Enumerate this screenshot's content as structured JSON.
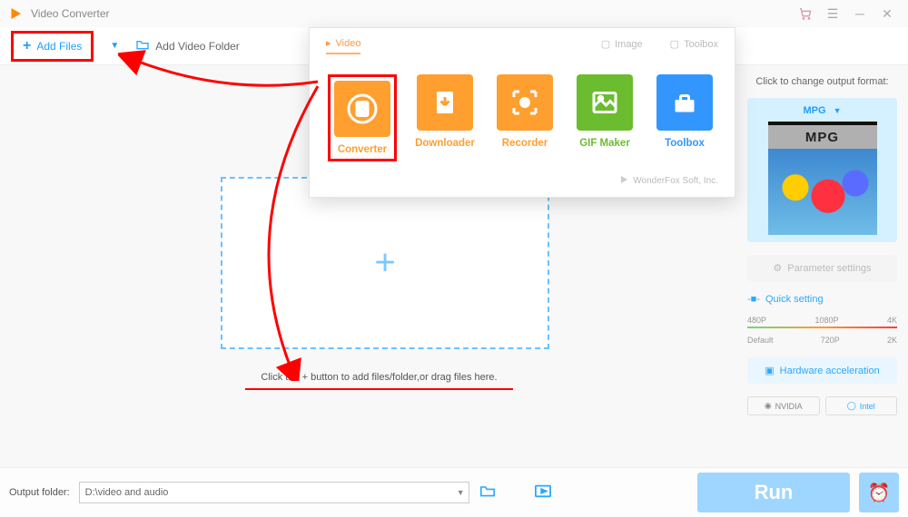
{
  "title": "Video Converter",
  "toolbar": {
    "add_files": "Add Files",
    "add_video_folder": "Add Video Folder"
  },
  "popover": {
    "tabs": {
      "video": "Video",
      "image": "Image",
      "toolbox": "Toolbox"
    },
    "items": {
      "converter": "Converter",
      "downloader": "Downloader",
      "recorder": "Recorder",
      "gif": "GIF Maker",
      "toolbox": "Toolbox"
    },
    "footer": "WonderFox Soft, Inc."
  },
  "dropzone": {
    "hint": "Click the + button to add files/folder,or drag files here."
  },
  "right": {
    "hint": "Click to change output format:",
    "format": "MPG",
    "mpg_thumb": "MPG",
    "param_settings": "Parameter settings",
    "quick_setting": "Quick setting",
    "scale_top": [
      "480P",
      "1080P",
      "4K"
    ],
    "scale_bottom": [
      "Default",
      "720P",
      "2K"
    ],
    "hardware_accel": "Hardware acceleration",
    "gpu_nvidia": "NVIDIA",
    "gpu_intel": "Intel"
  },
  "footer": {
    "output_folder_label": "Output folder:",
    "output_folder_value": "D:\\video and audio",
    "run": "Run"
  }
}
